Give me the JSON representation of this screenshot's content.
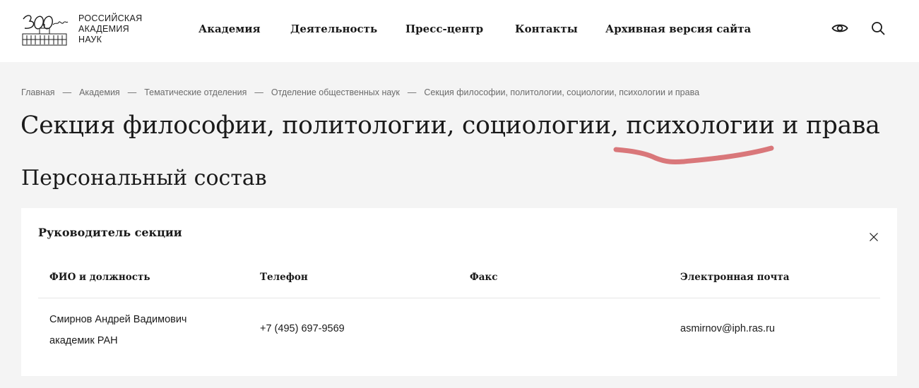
{
  "header": {
    "logo": {
      "anniversary": "300 лет",
      "lines": [
        "РОССИЙСКАЯ",
        "АКАДЕМИЯ",
        "НАУК"
      ]
    },
    "nav": [
      {
        "label": "Академия"
      },
      {
        "label": "Деятельность"
      },
      {
        "label": "Пресс-центр"
      },
      {
        "label": "Контакты"
      },
      {
        "label": "Архивная версия сайта"
      }
    ],
    "icons": [
      "eye-icon",
      "search-icon"
    ]
  },
  "breadcrumb": [
    "Главная",
    "Академия",
    "Тематические отделения",
    "Отделение общественных наук",
    "Секция философии, политологии, социологии, психологии и права"
  ],
  "breadcrumb_separator": "—",
  "page_title": "Секция философии, политологии, социологии, психологии и права",
  "section_title": "Персональный состав",
  "card": {
    "title": "Руководитель секции",
    "columns": [
      "ФИО и должность",
      "Телефон",
      "Факс",
      "Электронная почта"
    ],
    "rows": [
      {
        "name": "Смирнов Андрей Вадимович",
        "position": "академик РАН",
        "phone": "+7 (495) 697-9569",
        "fax": "",
        "email": "asmirnov@iph.ras.ru"
      }
    ]
  },
  "colors": {
    "background": "#f4f4f4",
    "header_bg": "#ffffff",
    "card_bg": "#ffffff",
    "text": "#1a1a1a",
    "muted": "#6b6b6b",
    "annotation": "#d9777a"
  }
}
